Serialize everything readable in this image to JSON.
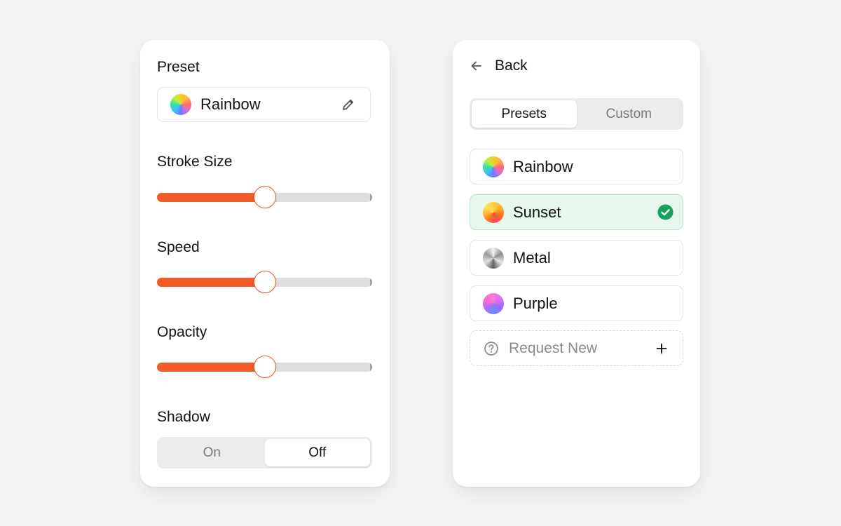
{
  "colors": {
    "accent": "#f15a29",
    "success": "#16a05d",
    "selected_bg": "#e8f7ee"
  },
  "left_panel": {
    "preset_label": "Preset",
    "preset_value": "Rainbow",
    "preset_swatch_icon": "rainbow-swatch",
    "edit_icon": "pencil-icon",
    "stroke_size_label": "Stroke Size",
    "stroke_size_value": 0.5,
    "speed_label": "Speed",
    "speed_value": 0.5,
    "opacity_label": "Opacity",
    "opacity_value": 0.5,
    "shadow_label": "Shadow",
    "shadow_options": [
      "On",
      "Off"
    ],
    "shadow_selected": "Off"
  },
  "right_panel": {
    "back_label": "Back",
    "tabs": [
      "Presets",
      "Custom"
    ],
    "active_tab": "Presets",
    "presets": [
      {
        "label": "Rainbow",
        "swatch": "rainbow"
      },
      {
        "label": "Sunset",
        "swatch": "sunset",
        "selected": true
      },
      {
        "label": "Metal",
        "swatch": "metal"
      },
      {
        "label": "Purple",
        "swatch": "purple"
      }
    ],
    "request_label": "Request New"
  }
}
